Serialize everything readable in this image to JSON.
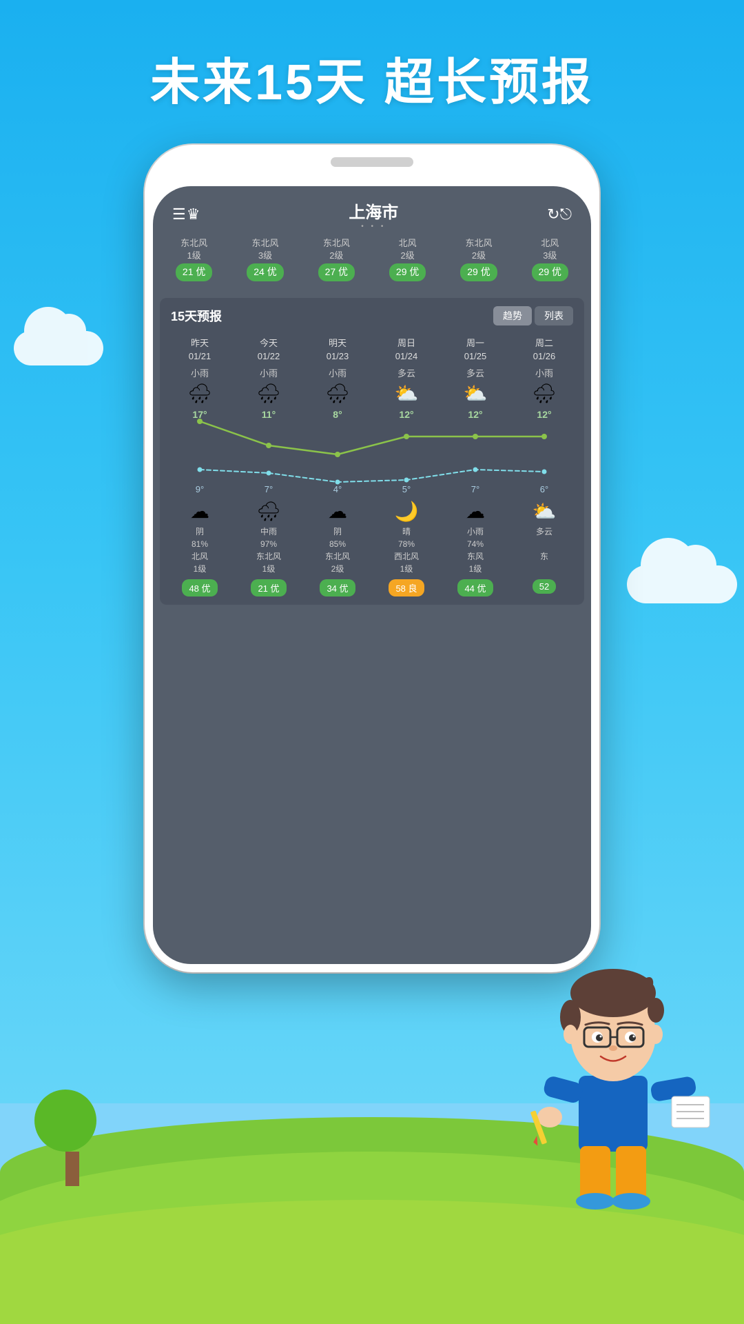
{
  "hero": {
    "title": "未来15天  超长预报"
  },
  "app": {
    "city": "上海市",
    "header_dots": "• • •",
    "menu_icon": "☰",
    "crown_icon": "♛",
    "refresh_icon": "↻",
    "share_icon": "⟳"
  },
  "top_aqi": {
    "items": [
      {
        "wind": "东北风",
        "level": "1级",
        "aqi": "21 优",
        "color": "green"
      },
      {
        "wind": "东北风",
        "level": "3级",
        "aqi": "24 优",
        "color": "green"
      },
      {
        "wind": "东北风",
        "level": "2级",
        "aqi": "27 优",
        "color": "green"
      },
      {
        "wind": "北风",
        "level": "2级",
        "aqi": "29 优",
        "color": "green"
      },
      {
        "wind": "东北风",
        "level": "2级",
        "aqi": "29 优",
        "color": "green"
      },
      {
        "wind": "北风",
        "level": "3级",
        "aqi": "29 优",
        "color": "green"
      }
    ]
  },
  "forecast": {
    "title": "15天预报",
    "tabs": [
      "趋势",
      "列表"
    ],
    "active_tab": "趋势",
    "days": [
      {
        "label": "昨天",
        "date": "01/21",
        "condition_day": "小雨",
        "high": "17°",
        "low": "9°",
        "condition_night": "阴",
        "humidity": "81%",
        "wind": "北风",
        "wind_level": "1级",
        "aqi": "48 优",
        "aqi_color": "green"
      },
      {
        "label": "今天",
        "date": "01/22",
        "condition_day": "小雨",
        "high": "11°",
        "low": "7°",
        "condition_night": "中雨",
        "humidity": "97%",
        "wind": "东北风",
        "wind_level": "1级",
        "aqi": "21 优",
        "aqi_color": "green"
      },
      {
        "label": "明天",
        "date": "01/23",
        "condition_day": "小雨",
        "high": "8°",
        "low": "4°",
        "condition_night": "阴",
        "humidity": "85%",
        "wind": "东北风",
        "wind_level": "2级",
        "aqi": "34 优",
        "aqi_color": "green"
      },
      {
        "label": "周日",
        "date": "01/24",
        "condition_day": "多云",
        "high": "12°",
        "low": "5°",
        "condition_night": "晴",
        "humidity": "78%",
        "wind": "西北风",
        "wind_level": "1级",
        "aqi": "58 良",
        "aqi_color": "yellow"
      },
      {
        "label": "周一",
        "date": "01/25",
        "condition_day": "多云",
        "high": "12°",
        "low": "7°",
        "condition_night": "小雨",
        "humidity": "74%",
        "wind": "东风",
        "wind_level": "1级",
        "aqi": "44 优",
        "aqi_color": "green"
      },
      {
        "label": "周二",
        "date": "01/26",
        "condition_day": "小雨",
        "high": "12°",
        "low": "6°",
        "condition_night": "多云",
        "humidity": "",
        "wind": "东",
        "wind_level": "",
        "aqi": "52",
        "aqi_color": "green"
      }
    ]
  }
}
